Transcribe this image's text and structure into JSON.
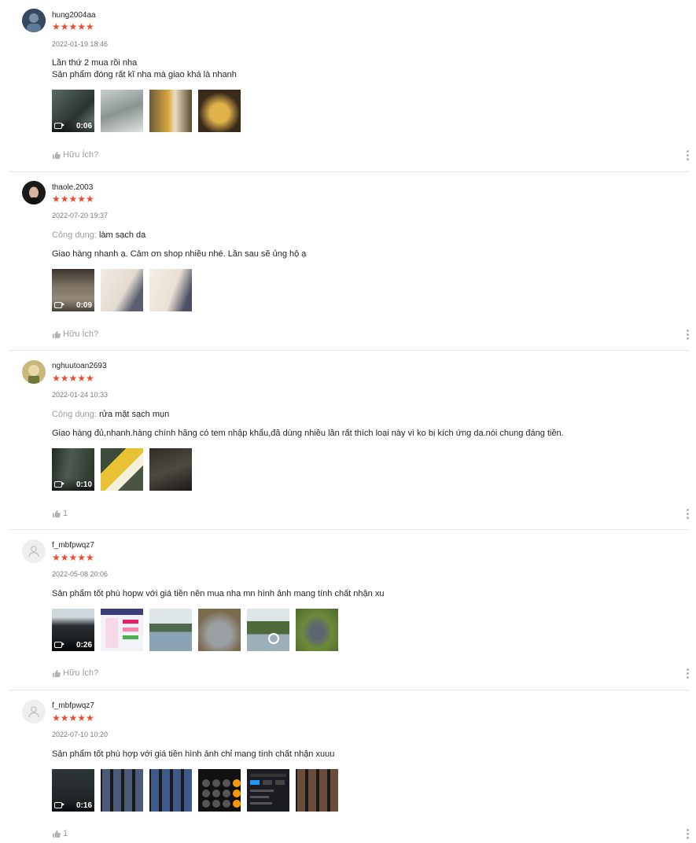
{
  "reviews": [
    {
      "username": "hung2004aa",
      "stars": "★★★★★",
      "date": "2022-01-19 18:46",
      "text": "Lần thứ 2 mua rồi nha\nSản phẩm đóng rất kĩ nha mà giao khá là nhanh",
      "video_duration": "0:06",
      "like_label": "Hữu Ích?"
    },
    {
      "username": "thaole.2003",
      "stars": "★★★★★",
      "date": "2022-07-20 19:37",
      "attr_key": "Công dụng:",
      "attr_value": "làm sạch da",
      "text": "Giao hàng nhanh ạ. Cảm ơn shop nhiều nhé. Lần sau sẽ ủng hộ ạ",
      "video_duration": "0:09",
      "like_label": "Hữu Ích?"
    },
    {
      "username": "nghuutoan2693",
      "stars": "★★★★★",
      "date": "2022-01-24 10:33",
      "attr_key": "Công dụng:",
      "attr_value": "rửa mặt sạch mụn",
      "text": "Giao hàng đủ,nhanh.hàng chính hãng có tem nhập khẩu,đã dùng nhiều lần rất thích loại này vì ko bị kích ứng da.nói chung đáng tiền.",
      "video_duration": "0:10",
      "like_label": "1"
    },
    {
      "username": "f_mbfpwqz7",
      "stars": "★★★★★",
      "date": "2022-05-08 20:06",
      "text": "Sản phẩm tốt phù hopw với giá tiền nên mua nha mn hình ảnh mang tính chất nhận xu",
      "video_duration": "0:26",
      "like_label": "Hữu Ích?"
    },
    {
      "username": "f_mbfpwqz7",
      "stars": "★★★★★",
      "date": "2022-07-10 10:20",
      "text": "Sản phẩm tốt phù hợp với giá tiền hình ảnh chỉ mang tính chất nhận xuuu",
      "video_duration": "0:16",
      "like_label": "1"
    }
  ],
  "colors": {
    "star": "#ee4d2d",
    "divider": "#e8e8e8"
  }
}
